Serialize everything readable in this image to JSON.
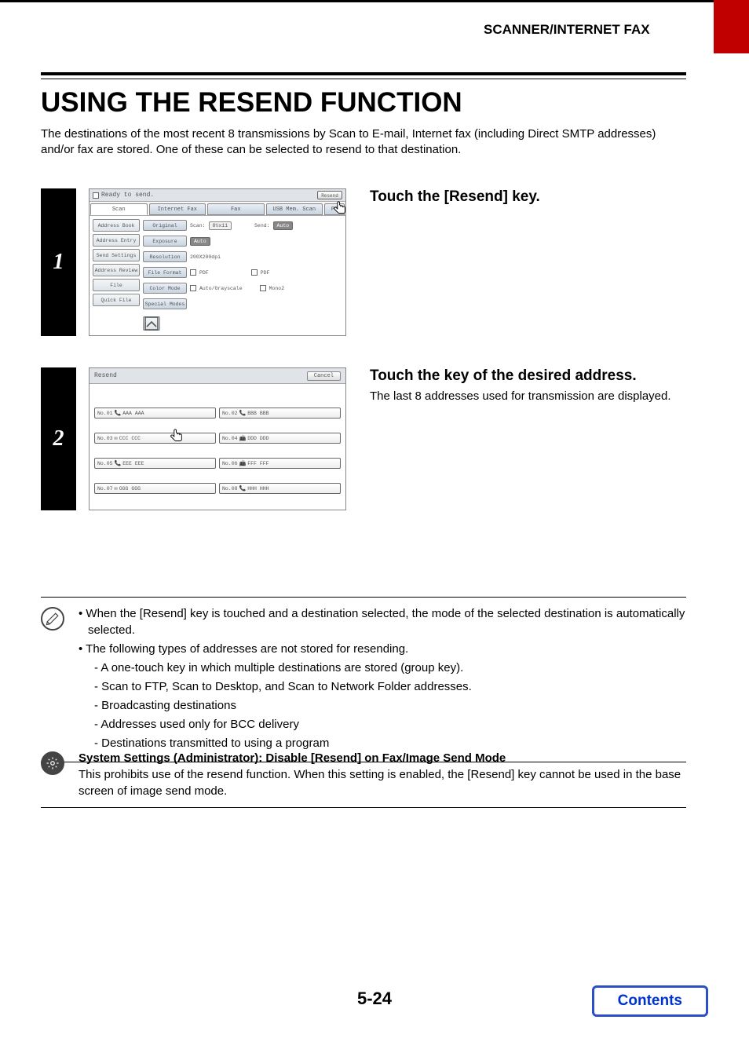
{
  "header": {
    "section": "SCANNER/INTERNET FAX"
  },
  "title": "USING THE RESEND FUNCTION",
  "intro": "The destinations of the most recent 8 transmissions by Scan to E-mail, Internet fax (including Direct SMTP addresses) and/or fax are stored. One of these can be selected to resend to that destination.",
  "step1": {
    "num": "1",
    "heading": "Touch the [Resend] key.",
    "screen": {
      "status": "Ready to send.",
      "resend": "Resend",
      "tabs": [
        "Scan",
        "Internet Fax",
        "Fax",
        "USB Mem. Scan",
        "PC"
      ],
      "left": [
        "Address Book",
        "Address Entry",
        "Send Settings",
        "Address Review",
        "File",
        "Quick File"
      ],
      "rows": [
        {
          "label": "Original",
          "t1": "Scan:",
          "v1": "8½x11",
          "t2": "Send:",
          "v2": "Auto"
        },
        {
          "label": "Exposure",
          "v": "Auto"
        },
        {
          "label": "Resolution",
          "v": "200X200dpi"
        },
        {
          "label": "File Format",
          "v1": "PDF",
          "v2": "PDF"
        },
        {
          "label": "Color Mode",
          "v1": "Auto/Grayscale",
          "v2": "Mono2"
        },
        {
          "label": "Special Modes"
        }
      ]
    }
  },
  "step2": {
    "num": "2",
    "heading": "Touch the key of the desired address.",
    "body": "The last 8 addresses used for transmission are displayed.",
    "screen": {
      "title": "Resend",
      "cancel": "Cancel",
      "items": [
        {
          "no": "No.01",
          "icon": "phone",
          "name": "AAA AAA"
        },
        {
          "no": "No.02",
          "icon": "phone",
          "name": "BBB BBB"
        },
        {
          "no": "No.03",
          "icon": "mail",
          "name": "CCC CCC"
        },
        {
          "no": "No.04",
          "icon": "fax",
          "name": "DDD DDD"
        },
        {
          "no": "No.05",
          "icon": "phone",
          "name": "EEE EEE"
        },
        {
          "no": "No.06",
          "icon": "fax",
          "name": "FFF FFF"
        },
        {
          "no": "No.07",
          "icon": "mail",
          "name": "GGG GGG"
        },
        {
          "no": "No.08",
          "icon": "phone",
          "name": "HHH HHH"
        }
      ]
    }
  },
  "notes1": {
    "b1": "When the [Resend] key is touched and a destination selected, the mode of the selected destination is automatically selected.",
    "b2": "The following types of addresses are not stored for resending.",
    "sub": [
      "A one-touch key in which multiple destinations are stored (group key).",
      "Scan to FTP, Scan to Desktop, and Scan to Network Folder addresses.",
      "Broadcasting destinations",
      "Addresses used only for BCC delivery",
      "Destinations transmitted to using a program"
    ]
  },
  "notes2": {
    "heading": "System Settings (Administrator): Disable [Resend] on Fax/Image Send Mode",
    "body": "This prohibits use of the resend function. When this setting is enabled, the [Resend] key cannot be used in the base screen of image send mode."
  },
  "footer": {
    "page": "5-24",
    "contents": "Contents"
  }
}
